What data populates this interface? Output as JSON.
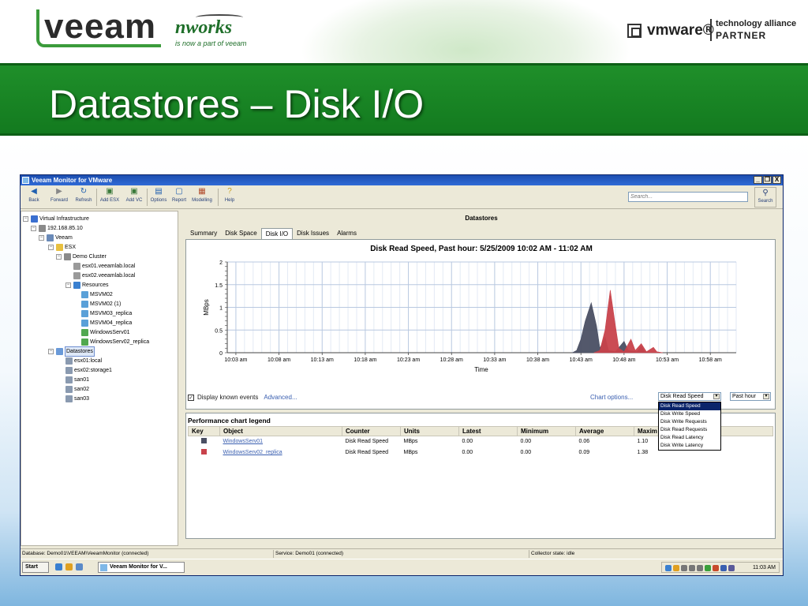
{
  "slide": {
    "veeam_logo": "veeam",
    "nworks_logo": "nworks",
    "nworks_tagline": "is now a part of veeam",
    "vmware_logo": "vmware®",
    "partner_line1": "technology alliance",
    "partner_line2": "PARTNER",
    "title": "Datastores – Disk I/O"
  },
  "app": {
    "window_title": "Veeam Monitor for VMware",
    "window_buttons": [
      "_",
      "❐",
      "X"
    ],
    "toolbar": [
      {
        "label": "Back",
        "icon": "back-arrow-icon"
      },
      {
        "label": "Forward",
        "icon": "forward-arrow-icon"
      },
      {
        "label": "Refresh",
        "icon": "refresh-icon"
      },
      {
        "label": "Add ESX",
        "icon": "add-esx-icon"
      },
      {
        "label": "Add VC",
        "icon": "add-vc-icon"
      },
      {
        "label": "Options",
        "icon": "options-icon"
      },
      {
        "label": "Report",
        "icon": "report-icon"
      },
      {
        "label": "Modelling",
        "icon": "modelling-icon"
      },
      {
        "label": "Help",
        "icon": "help-icon"
      }
    ],
    "search_placeholder": "Search...",
    "search_label": "Search",
    "tree": [
      {
        "label": "Virtual Infrastructure",
        "toggle": "⊟",
        "icon_color": "#3a6fd0"
      },
      {
        "label": "192.168.85.10",
        "toggle": "⊟",
        "icon_color": "#8a8a8a"
      },
      {
        "label": "Veeam",
        "toggle": "⊟",
        "icon_color": "#6a8ab8"
      },
      {
        "label": "ESX",
        "toggle": "⊟",
        "icon_color": "#e8c040"
      },
      {
        "label": "Demo Cluster",
        "toggle": "⊟",
        "icon_color": "#8a8a8a"
      },
      {
        "label": "esx01.veeamlab.local",
        "toggle": "",
        "icon_color": "#9a9a9a"
      },
      {
        "label": "esx02.veeamlab.local",
        "toggle": "",
        "icon_color": "#9a9a9a"
      },
      {
        "label": "Resources",
        "toggle": "⊟",
        "icon_color": "#3a80d0"
      },
      {
        "label": "MSVM02",
        "toggle": "",
        "icon_color": "#5aa0d8"
      },
      {
        "label": "MSVM02 (1)",
        "toggle": "",
        "icon_color": "#5aa0d8"
      },
      {
        "label": "MSVM03_replica",
        "toggle": "",
        "icon_color": "#5aa0d8"
      },
      {
        "label": "MSVM04_replica",
        "toggle": "",
        "icon_color": "#5aa0d8"
      },
      {
        "label": "WindowsServ01",
        "toggle": "",
        "icon_color": "#50a850"
      },
      {
        "label": "WindowsServ02_replica",
        "toggle": "",
        "icon_color": "#50a850"
      },
      {
        "label": "Datastores",
        "toggle": "⊟",
        "icon_color": "#6a9ad8",
        "selected": true
      },
      {
        "label": "esx01:local",
        "toggle": "",
        "icon_color": "#8a9ab0"
      },
      {
        "label": "esx02:storage1",
        "toggle": "",
        "icon_color": "#8a9ab0"
      },
      {
        "label": "san01",
        "toggle": "",
        "icon_color": "#8a9ab0"
      },
      {
        "label": "san02",
        "toggle": "",
        "icon_color": "#8a9ab0"
      },
      {
        "label": "san03",
        "toggle": "",
        "icon_color": "#8a9ab0"
      }
    ],
    "main_title": "Datastores",
    "tabs": [
      "Summary",
      "Disk Space",
      "Disk I/O",
      "Disk Issues",
      "Alarms"
    ],
    "active_tab": "Disk I/O",
    "events_label": "Display known events",
    "events_checked": "✓",
    "advanced_label": "Advanced...",
    "chart_options_label": "Chart options...",
    "counter_selected": "Disk Read Speed",
    "counter_options": [
      "Disk Read Speed",
      "Disk Write Speed",
      "Disk Write Requests",
      "Disk Read Requests",
      "Disk Read Latency",
      "Disk Write Latency"
    ],
    "period_selected": "Past hour",
    "legend_title": "Performance chart legend",
    "legend_columns": [
      "Key",
      "Object",
      "Counter",
      "Units",
      "Latest",
      "Minimum",
      "Average",
      "Maxim"
    ],
    "legend_rows": [
      {
        "color": "#4a4f63",
        "object": "WindowsServ01",
        "counter": "Disk Read Speed",
        "units": "MBps",
        "latest": "0.00",
        "minimum": "0.00",
        "average": "0.06",
        "maximum": "1.10"
      },
      {
        "color": "#c8424b",
        "object": "WindowsServ02_replica",
        "counter": "Disk Read Speed",
        "units": "MBps",
        "latest": "0.00",
        "minimum": "0.00",
        "average": "0.09",
        "maximum": "1.38"
      }
    ],
    "status": {
      "database": "Database: Demo01\\VEEAM\\VeeamMonitor (connected)",
      "service": "Service: Demo01 (connected)",
      "collector": "Collector state:  idle"
    },
    "taskbar": {
      "start": "Start",
      "task": "Veeam Monitor for V...",
      "clock": "11:03 AM"
    }
  },
  "chart_data": {
    "type": "area",
    "title": "Disk Read Speed, Past hour: 5/25/2009 10:02 AM - 11:02 AM",
    "xlabel": "Time",
    "ylabel": "MBps",
    "ylim": [
      0,
      2
    ],
    "yticks": [
      0,
      0.5,
      1,
      1.5,
      2
    ],
    "xlim_minutes": [
      0,
      59
    ],
    "xticks": [
      "10:03 am",
      "10:08 am",
      "10:13 am",
      "10:18 am",
      "10:23 am",
      "10:28 am",
      "10:33 am",
      "10:38 am",
      "10:43 am",
      "10:48 am",
      "10:53 am",
      "10:58 am"
    ],
    "grid": true,
    "series": [
      {
        "color": "#4a4f63",
        "points": [
          [
            40.0,
            0
          ],
          [
            40.5,
            0.05
          ],
          [
            41.0,
            0.3
          ],
          [
            41.5,
            0.7
          ],
          [
            42.2,
            1.1
          ],
          [
            42.8,
            0.6
          ],
          [
            43.2,
            0.1
          ],
          [
            43.8,
            0.35
          ],
          [
            44.2,
            0.05
          ],
          [
            45.0,
            0.02
          ],
          [
            46.0,
            0.25
          ],
          [
            46.5,
            0.05
          ],
          [
            47.5,
            0.02
          ],
          [
            48.0,
            0.15
          ],
          [
            48.4,
            0.02
          ],
          [
            49.0,
            0
          ]
        ]
      },
      {
        "color": "#c8424b",
        "points": [
          [
            42.5,
            0
          ],
          [
            43.2,
            0.05
          ],
          [
            43.8,
            0.5
          ],
          [
            44.4,
            1.38
          ],
          [
            45.0,
            0.6
          ],
          [
            45.4,
            0.1
          ],
          [
            46.0,
            0.02
          ],
          [
            46.8,
            0.3
          ],
          [
            47.3,
            0.05
          ],
          [
            48.0,
            0.2
          ],
          [
            48.6,
            0.02
          ],
          [
            49.4,
            0.12
          ],
          [
            49.8,
            0.02
          ],
          [
            50.5,
            0
          ]
        ]
      }
    ]
  }
}
